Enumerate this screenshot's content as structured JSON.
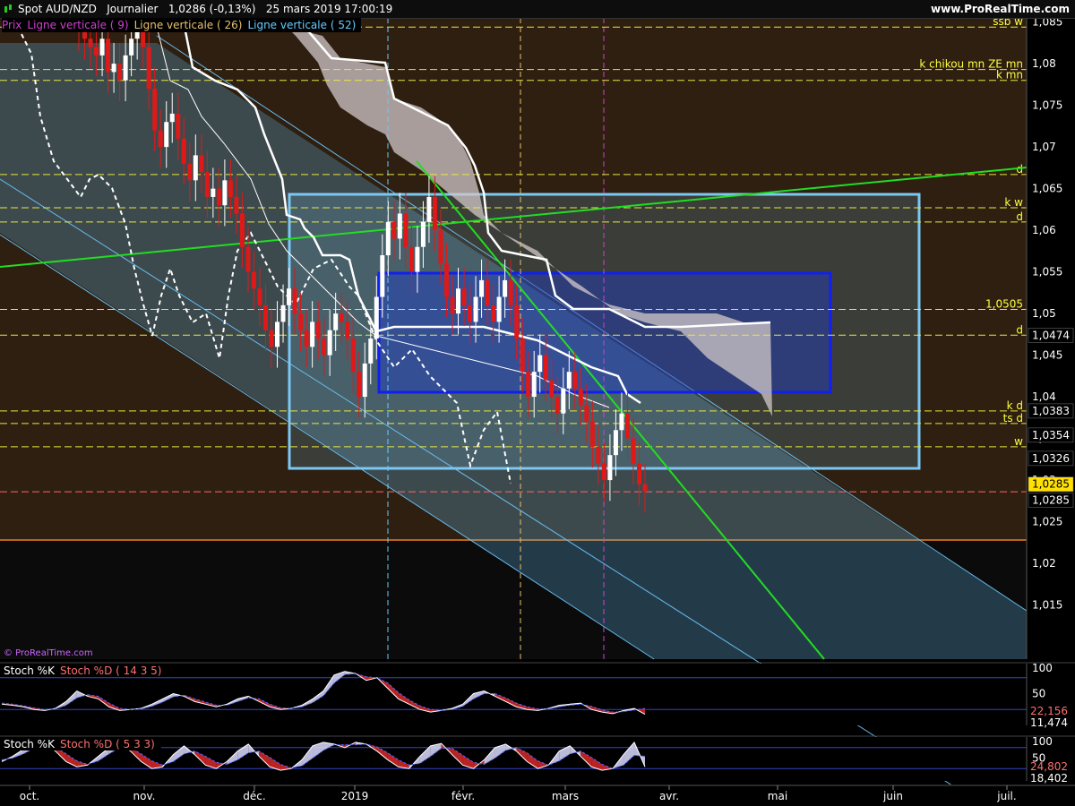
{
  "header": {
    "title": "Spot AUD/NZD   Journalier   1,0286 (-0,13%)   25 mars 2019 17:00:19",
    "brand": "www.ProRealTime.com"
  },
  "legend": [
    {
      "label": "Prix",
      "color": "#d040d0"
    },
    {
      "label": "Ligne verticale ( 9)",
      "color": "#d040d0"
    },
    {
      "label": "Ligne verticale ( 26)",
      "color": "#e8c070"
    },
    {
      "label": "Ligne verticale ( 52)",
      "color": "#66ccff"
    }
  ],
  "watermark": "© ProRealTime.com",
  "chart_data": [
    {
      "type": "candlestick",
      "x_ticks": [
        "oct.",
        "nov.",
        "déc.",
        "2019",
        "janv.",
        "févr.",
        "mars",
        "avr.",
        "mai",
        "juin",
        "juil."
      ],
      "ylim": [
        1.0085,
        1.0855
      ],
      "y_ticks": [
        "1,085",
        "1,08",
        "1,075",
        "1,07",
        "1,065",
        "1,06",
        "1,055",
        "1,05",
        "1,045",
        "1,04",
        "1,035",
        "1,03",
        "1,025",
        "1,02",
        "1,015"
      ],
      "last_price": "1,0285",
      "horizontal_lines": [
        {
          "label": "ssb w",
          "value": 1.0844
        },
        {
          "label": "k chikou mn ZE mn",
          "value": 1.0793
        },
        {
          "label": "k mn",
          "value": 1.078
        },
        {
          "label": "d",
          "value": 1.0667
        },
        {
          "label": "k w",
          "value": 1.0627
        },
        {
          "label": "d",
          "value": 1.061
        },
        {
          "label": "1,0505",
          "value": 1.0505
        },
        {
          "label": "d",
          "value": 1.0474
        },
        {
          "label": "k d",
          "value": 1.0383
        },
        {
          "label": "ts d",
          "value": 1.0368
        },
        {
          "label": "w",
          "value": 1.034
        }
      ],
      "price_boxes": [
        "1,0474",
        "1,0383",
        "1,0354",
        "1,0326",
        "1,0285",
        "1,0285"
      ],
      "candles_close": [
        1.084,
        1.083,
        1.082,
        1.081,
        1.083,
        1.079,
        1.08,
        1.078,
        1.081,
        1.083,
        1.084,
        1.082,
        1.077,
        1.072,
        1.07,
        1.073,
        1.074,
        1.071,
        1.068,
        1.066,
        1.069,
        1.067,
        1.064,
        1.065,
        1.063,
        1.066,
        1.064,
        1.062,
        1.058,
        1.055,
        1.053,
        1.051,
        1.048,
        1.046,
        1.049,
        1.051,
        1.053,
        1.05,
        1.048,
        1.046,
        1.049,
        1.047,
        1.045,
        1.048,
        1.05,
        1.049,
        1.047,
        1.043,
        1.04,
        1.044,
        1.047,
        1.052,
        1.057,
        1.061,
        1.059,
        1.062,
        1.058,
        1.055,
        1.058,
        1.061,
        1.064,
        1.06,
        1.056,
        1.052,
        1.05,
        1.053,
        1.051,
        1.049,
        1.052,
        1.054,
        1.051,
        1.049,
        1.052,
        1.054,
        1.051,
        1.047,
        1.043,
        1.04,
        1.043,
        1.045,
        1.042,
        1.04,
        1.038,
        1.041,
        1.043,
        1.041,
        1.039,
        1.037,
        1.034,
        1.032,
        1.03,
        1.033,
        1.036,
        1.038,
        1.035,
        1.032,
        1.0295,
        1.0286
      ]
    },
    {
      "type": "line",
      "title": "Stoch %K",
      "series": [
        {
          "name": "Stoch %K"
        },
        {
          "name": "Stoch %D ( 14 3 5)"
        }
      ],
      "ylim": [
        0,
        100
      ],
      "y_ticks": [
        "100",
        "50"
      ],
      "last_values": [
        "22,156",
        "11,474"
      ],
      "k": [
        30,
        28,
        25,
        20,
        18,
        22,
        35,
        55,
        45,
        40,
        25,
        18,
        20,
        22,
        30,
        40,
        50,
        45,
        35,
        30,
        25,
        30,
        40,
        45,
        35,
        25,
        20,
        22,
        28,
        40,
        55,
        85,
        92,
        88,
        75,
        80,
        60,
        40,
        30,
        20,
        15,
        18,
        22,
        30,
        50,
        55,
        45,
        35,
        25,
        20,
        18,
        22,
        28,
        30,
        32,
        20,
        15,
        12,
        18,
        22,
        11
      ],
      "d": [
        32,
        30,
        27,
        23,
        20,
        21,
        28,
        42,
        48,
        45,
        32,
        22,
        20,
        21,
        26,
        34,
        44,
        47,
        40,
        34,
        28,
        28,
        35,
        42,
        40,
        30,
        23,
        22,
        25,
        33,
        46,
        70,
        86,
        88,
        82,
        80,
        70,
        52,
        38,
        27,
        20,
        18,
        20,
        26,
        40,
        50,
        50,
        42,
        32,
        25,
        21,
        21,
        25,
        28,
        30,
        26,
        19,
        15,
        16,
        19,
        22
      ]
    },
    {
      "type": "line",
      "title": "Stoch %K",
      "series": [
        {
          "name": "Stoch %K"
        },
        {
          "name": "Stoch %D ( 5 3 3)"
        }
      ],
      "ylim": [
        0,
        100
      ],
      "y_ticks": [
        "100",
        "50"
      ],
      "last_values": [
        "24,802",
        "18,402"
      ],
      "k": [
        40,
        55,
        75,
        90,
        95,
        70,
        40,
        25,
        30,
        55,
        80,
        92,
        70,
        40,
        20,
        25,
        60,
        85,
        60,
        30,
        20,
        40,
        70,
        90,
        55,
        25,
        15,
        20,
        45,
        85,
        95,
        90,
        80,
        95,
        90,
        70,
        45,
        25,
        20,
        55,
        85,
        92,
        60,
        30,
        20,
        45,
        80,
        90,
        70,
        40,
        20,
        30,
        70,
        85,
        55,
        25,
        15,
        20,
        60,
        95,
        25
      ],
      "d": [
        45,
        50,
        62,
        78,
        88,
        82,
        62,
        42,
        32,
        42,
        62,
        80,
        80,
        62,
        42,
        30,
        40,
        62,
        70,
        55,
        38,
        32,
        45,
        65,
        70,
        52,
        32,
        22,
        28,
        50,
        72,
        88,
        88,
        88,
        90,
        82,
        65,
        45,
        30,
        35,
        55,
        78,
        78,
        58,
        38,
        32,
        50,
        72,
        80,
        65,
        42,
        30,
        42,
        62,
        70,
        52,
        32,
        20,
        30,
        58,
        55
      ]
    }
  ],
  "colors": {
    "up": "#ffffff",
    "down": "#e01818",
    "channel": "#66bbee",
    "trend": "#22dd22",
    "kijun": "#ffffff",
    "cloud": "#c8c8c8",
    "level": "#e8e840"
  }
}
